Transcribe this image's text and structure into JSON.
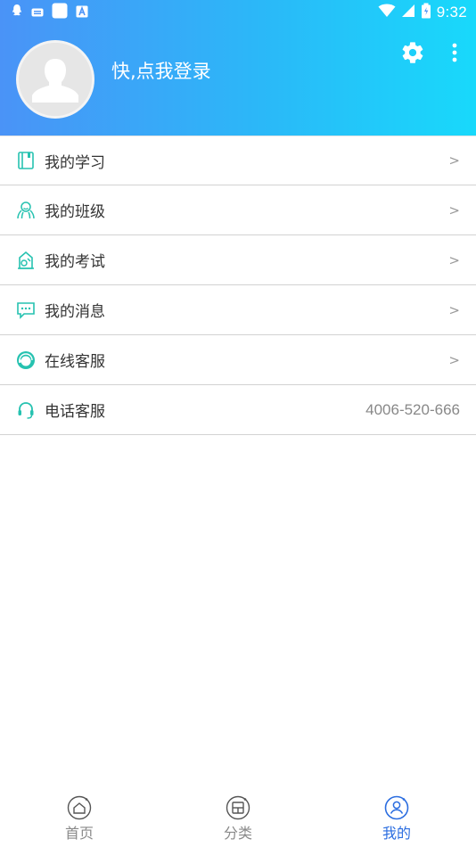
{
  "status_bar": {
    "time": "9:32",
    "left_icons": [
      "qq-icon",
      "mail-icon",
      "app-icon",
      "font-icon"
    ],
    "right_icons": [
      "wifi-icon",
      "signal-icon",
      "battery-icon"
    ]
  },
  "header": {
    "login_prompt": "快,点我登录",
    "gradient_start": "#4a93f7",
    "gradient_end": "#18d9fb"
  },
  "menu": {
    "items": [
      {
        "label": "我的学习",
        "icon": "book-icon",
        "arrow": ">"
      },
      {
        "label": "我的班级",
        "icon": "class-icon",
        "arrow": ">"
      },
      {
        "label": "我的考试",
        "icon": "exam-icon",
        "arrow": ">"
      },
      {
        "label": "我的消息",
        "icon": "message-icon",
        "arrow": ">"
      },
      {
        "label": "在线客服",
        "icon": "online-service-icon",
        "arrow": ">"
      },
      {
        "label": "电话客服",
        "icon": "headset-icon",
        "value": "4006-520-666"
      }
    ]
  },
  "tabbar": {
    "tabs": [
      {
        "label": "首页",
        "icon": "home-icon"
      },
      {
        "label": "分类",
        "icon": "category-icon"
      },
      {
        "label": "我的",
        "icon": "profile-icon"
      }
    ],
    "active_tab": "我的",
    "active_color": "#2b6de0",
    "inactive_color": "#8a8a8a"
  },
  "colors": {
    "menu_icon_accent": "#26c2b0"
  }
}
